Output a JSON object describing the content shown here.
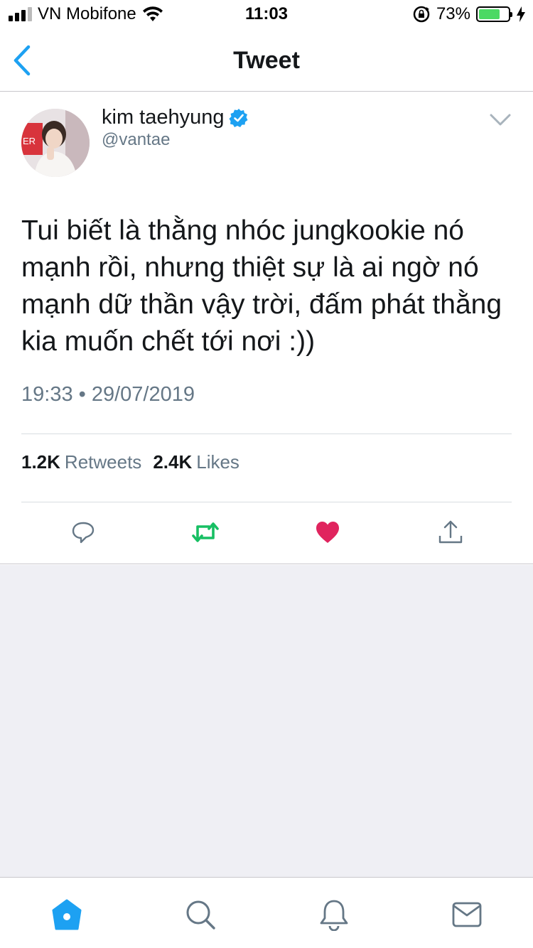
{
  "status_bar": {
    "carrier": "VN Mobifone",
    "time": "11:03",
    "battery_percent": "73%",
    "battery_level": 0.73,
    "battery_color": "#4cd964"
  },
  "header": {
    "title": "Tweet",
    "back_icon": "chevron-left-icon",
    "accent_color": "#1da1f2"
  },
  "tweet": {
    "author_name": "kim taehyung",
    "handle": "@vantae",
    "verified": true,
    "text": "Tui biết là thằng nhóc jungkookie nó mạnh rồi, nhưng thiệt sự là ai ngờ nó mạnh dữ thần vậy trời, đấm phát thằng kia muốn chết tới nơi :))",
    "timestamp": "19:33 • 29/07/2019",
    "retweets_count": "1.2K",
    "retweets_label": "Retweets",
    "likes_count": "2.4K",
    "likes_label": "Likes",
    "liked": true,
    "like_color": "#e0245e",
    "retweet_color": "#17bf63"
  },
  "tab_bar": {
    "tabs": [
      "home-icon",
      "search-icon",
      "notifications-icon",
      "messages-icon"
    ],
    "active": "home-icon"
  }
}
